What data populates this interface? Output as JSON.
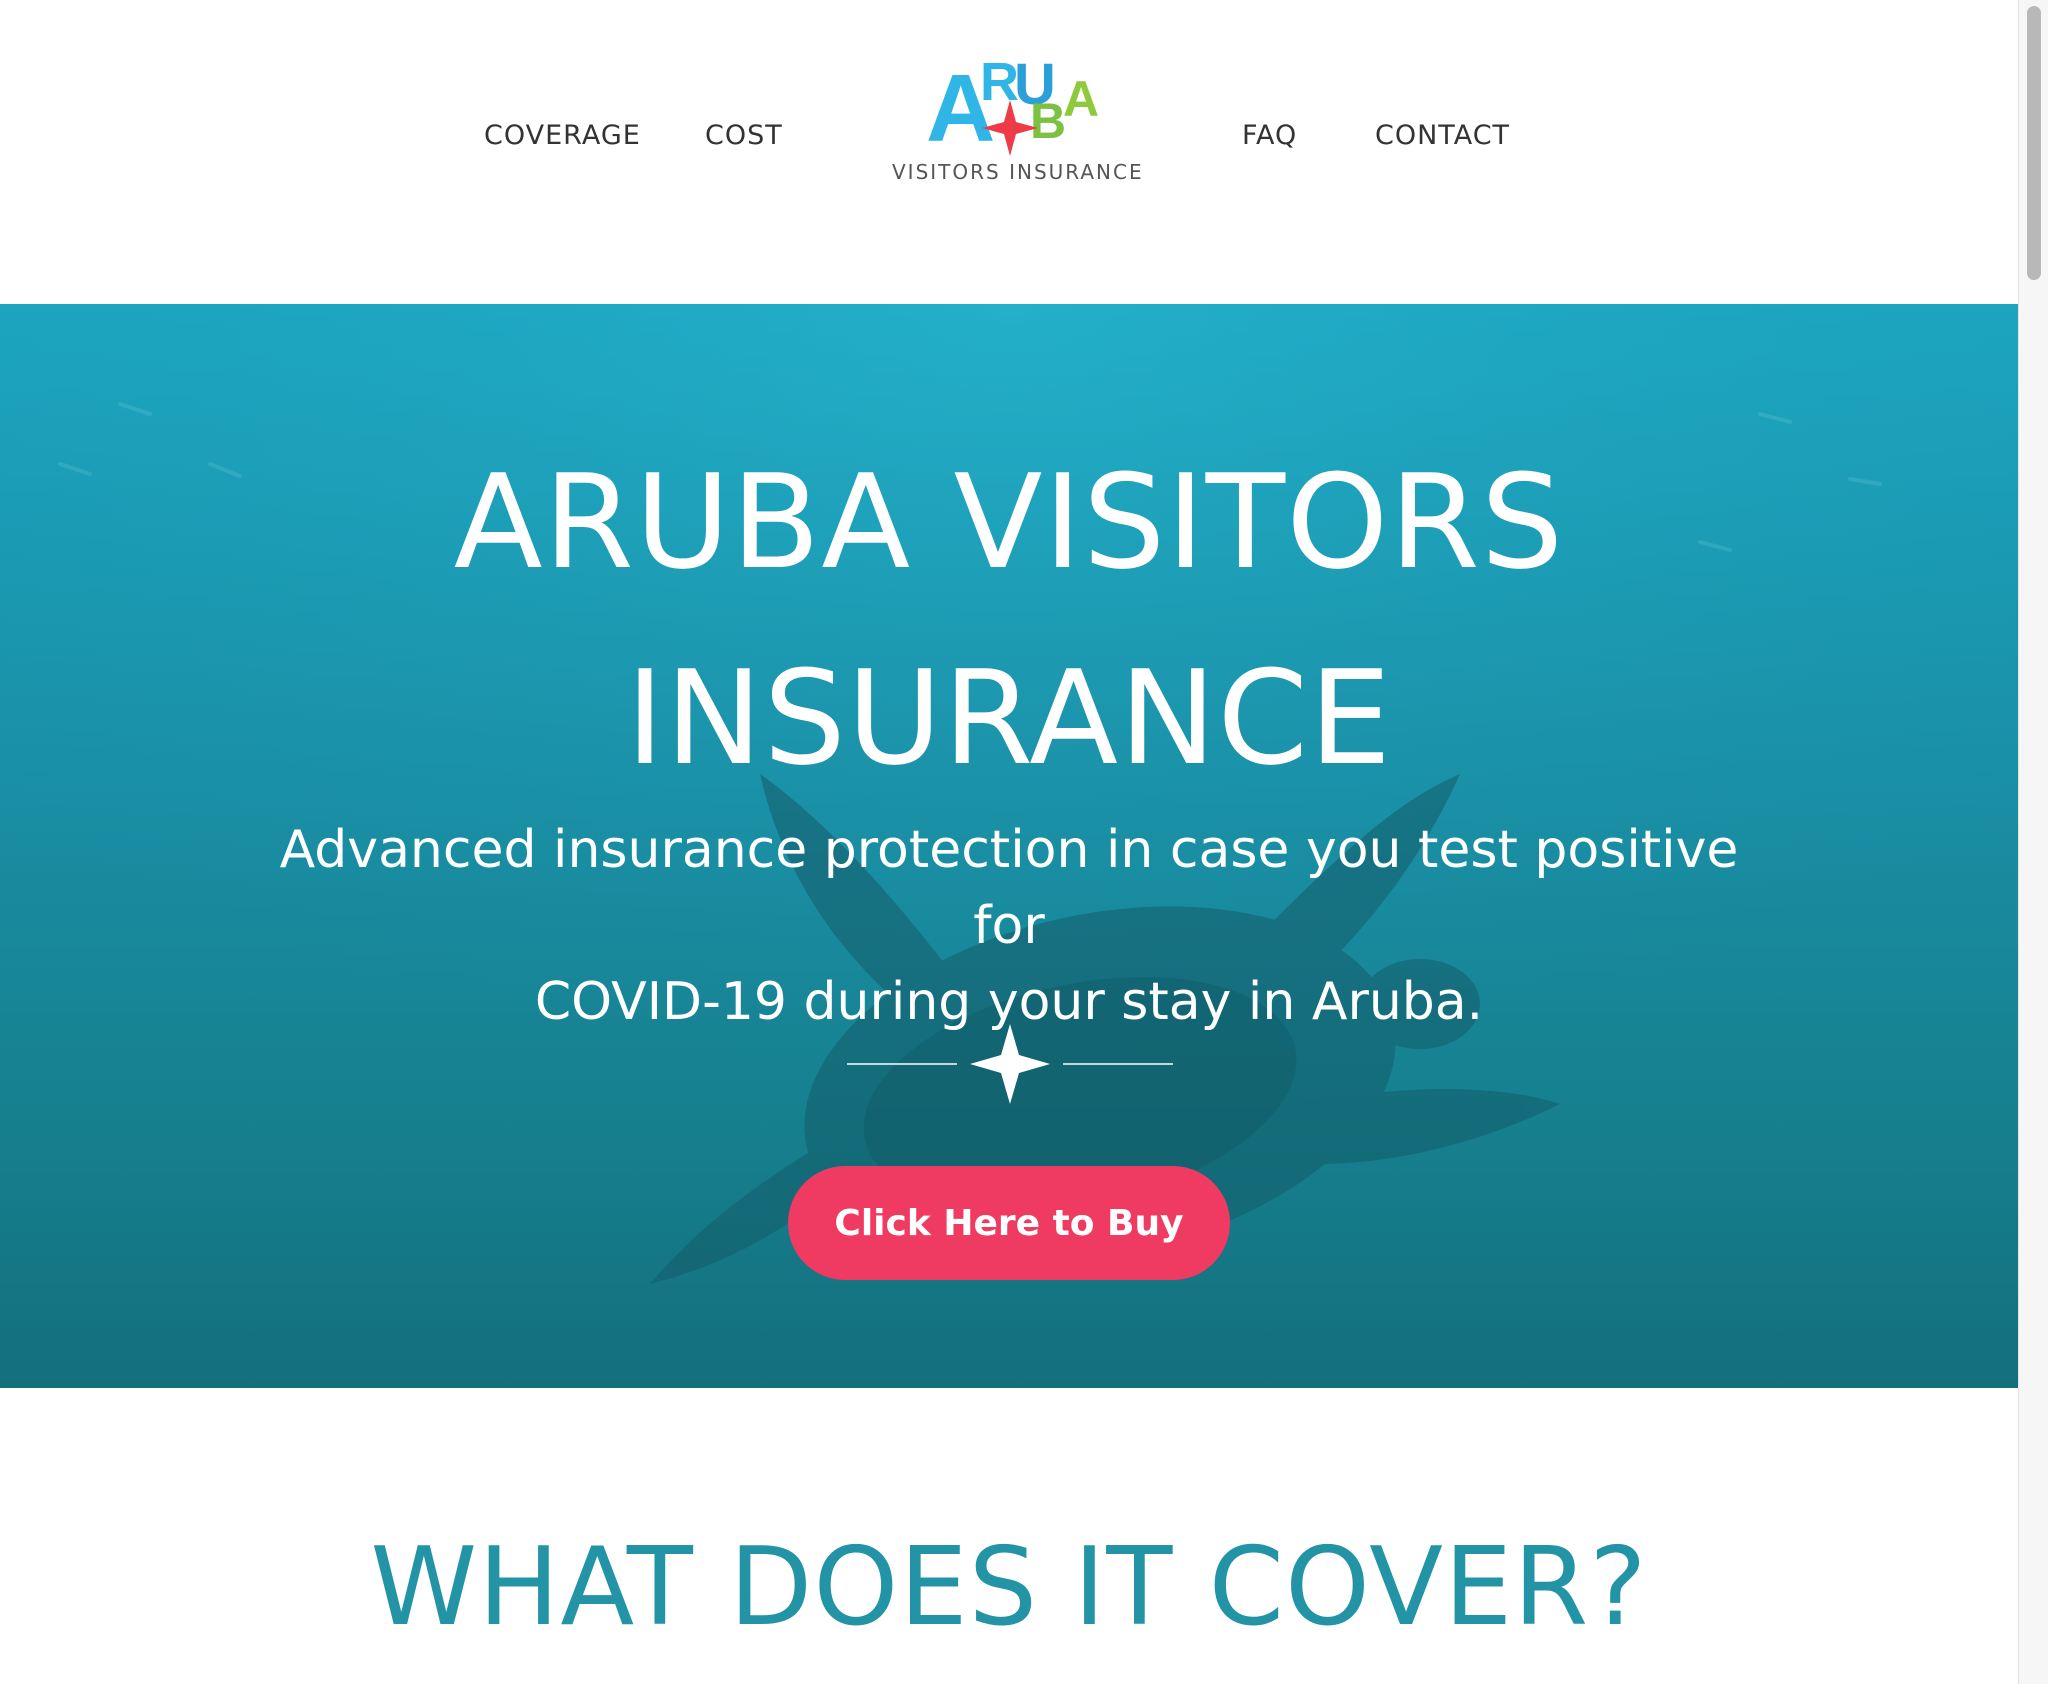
{
  "nav": {
    "left": [
      {
        "label": "COVERAGE"
      },
      {
        "label": "COST"
      }
    ],
    "right": [
      {
        "label": "FAQ"
      },
      {
        "label": "CONTACT"
      }
    ]
  },
  "logo": {
    "letters": [
      "A",
      "R",
      "U",
      "B",
      "A"
    ],
    "subtitle": "VISITORS INSURANCE"
  },
  "hero": {
    "title_line1": "ARUBA VISITORS",
    "title_line2": "INSURANCE",
    "subtitle_line1": "Advanced insurance protection in case you test positive for",
    "subtitle_line2": "COVID-19 during your stay in Aruba.",
    "cta_label": "Click Here to Buy"
  },
  "coverage": {
    "title": "WHAT DOES IT COVER?"
  },
  "colors": {
    "accent": "#ef3a62",
    "hero_teal": "#1a93ab",
    "section_title": "#2394a6",
    "logo_blue": "#2fb6e6",
    "logo_green": "#7cc142",
    "logo_red": "#ef3a47"
  }
}
